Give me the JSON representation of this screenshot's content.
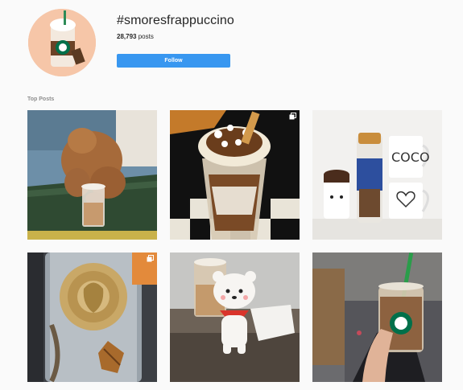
{
  "header": {
    "hashtag": "#smoresfrappuccino",
    "posts_count": "28,793",
    "posts_label": "posts",
    "follow_label": "Follow"
  },
  "section": {
    "label": "Top Posts"
  },
  "grid": {
    "posts": [
      {
        "subject": "dog-with-frappuccino"
      },
      {
        "subject": "smores-frappuccino-closeup",
        "icon": "multiple-posts-icon"
      },
      {
        "subject": "mugs-with-coffee-creamer"
      },
      {
        "subject": "decorated-starbucks-tumbler",
        "icon": "multiple-posts-icon"
      },
      {
        "subject": "plush-toy-with-drinks"
      },
      {
        "subject": "hand-holding-iced-drink"
      }
    ]
  },
  "mugs": {
    "mug_text": "COCO"
  },
  "colors": {
    "follow_button": "#3897f0",
    "background": "#fafafa",
    "avatar_bg": "#f6c6a8"
  }
}
